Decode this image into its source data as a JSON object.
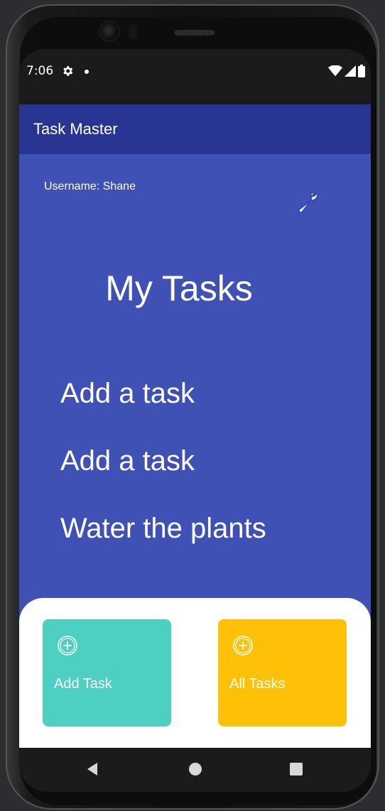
{
  "status_bar": {
    "time": "7:06"
  },
  "app_bar": {
    "title": "Task Master"
  },
  "main": {
    "username": "Username: Shane",
    "heading": "My Tasks",
    "tasks": [
      {
        "title": "Add a task"
      },
      {
        "title": "Add a task"
      },
      {
        "title": "Water the plants"
      }
    ]
  },
  "actions": {
    "add_task_label": "Add Task",
    "all_tasks_label": "All Tasks"
  },
  "colors": {
    "app_bar": "#283593",
    "content_bg": "#3f51b5",
    "add_task_card": "#4dd0c1",
    "all_tasks_card": "#ffc107"
  },
  "icons": {
    "settings": "wrench-icon",
    "add_task": "add-circle-icon",
    "all_tasks": "add-circle-icon"
  }
}
